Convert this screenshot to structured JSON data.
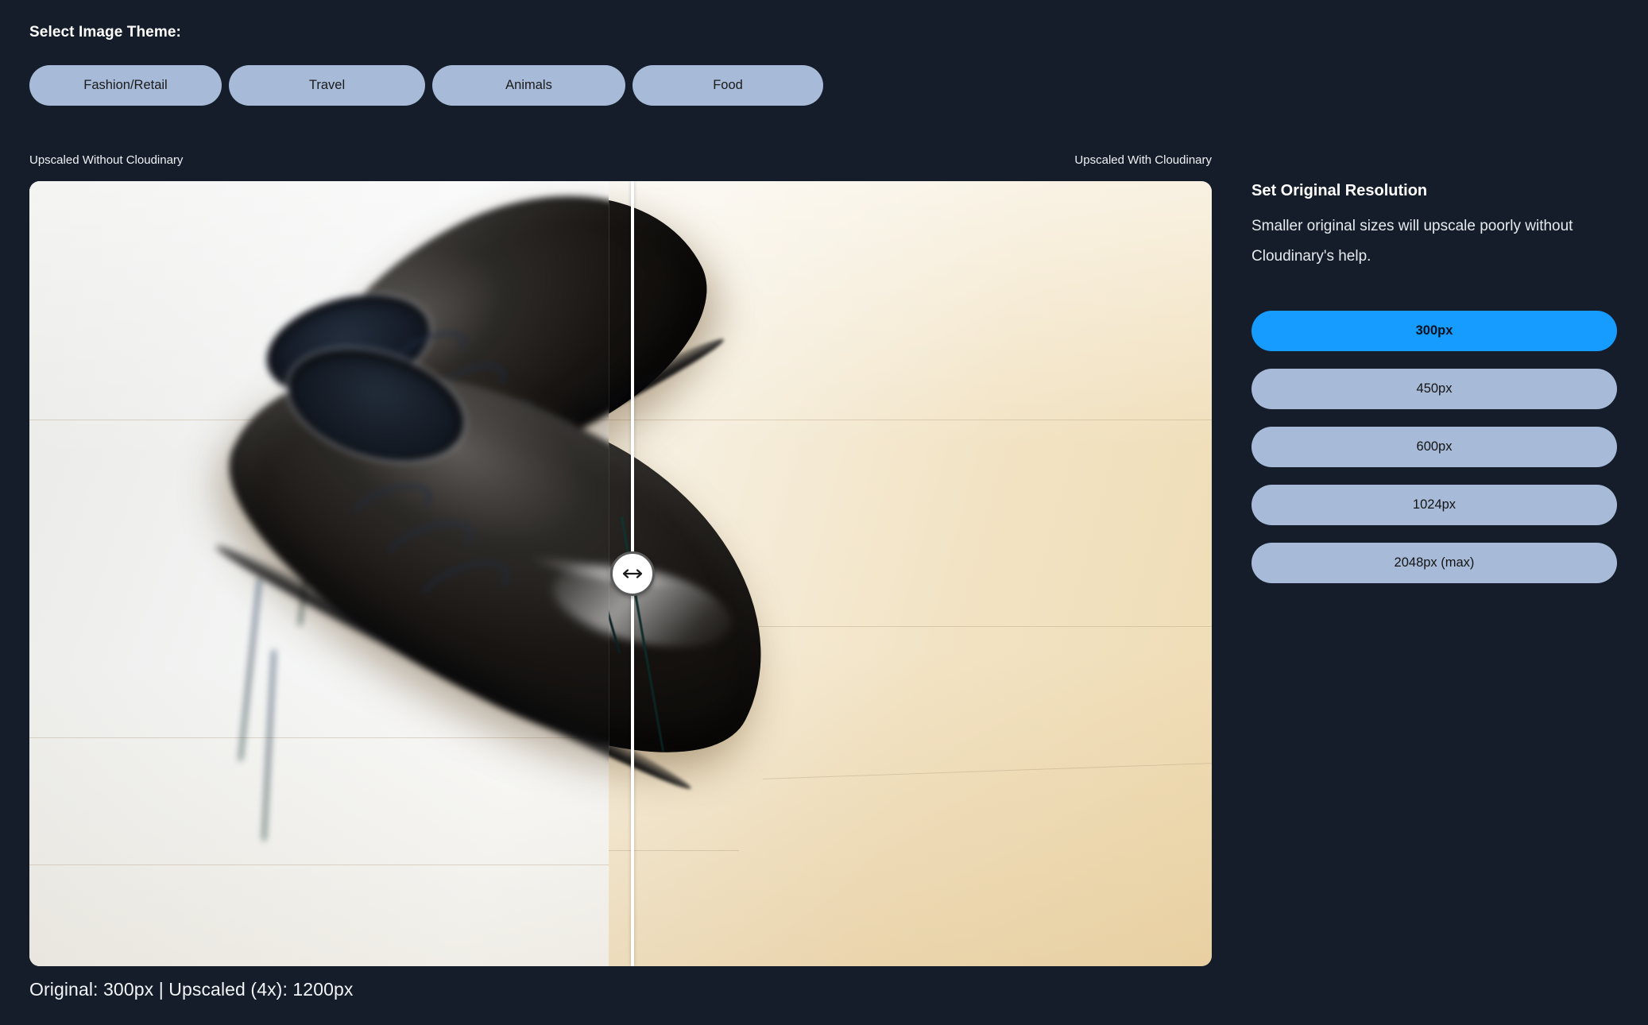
{
  "theme_selector": {
    "label": "Select Image Theme:",
    "options": [
      {
        "label": "Fashion/Retail",
        "selected": true
      },
      {
        "label": "Travel",
        "selected": false
      },
      {
        "label": "Animals",
        "selected": false
      },
      {
        "label": "Food",
        "selected": false
      }
    ]
  },
  "comparison": {
    "left_label": "Upscaled Without Cloudinary",
    "right_label": "Upscaled With Cloudinary",
    "handle_icon": "left-right-arrow-icon",
    "divider_position_percent": 51,
    "subject": "black leather dress shoes"
  },
  "footer": {
    "caption": "Original: 300px | Upscaled (4x): 1200px"
  },
  "side_panel": {
    "title": "Set Original Resolution",
    "description": "Smaller original sizes will upscale poorly without Cloudinary's help.",
    "resolutions": [
      {
        "label": "300px",
        "selected": true
      },
      {
        "label": "450px",
        "selected": false
      },
      {
        "label": "600px",
        "selected": false
      },
      {
        "label": "1024px",
        "selected": false
      },
      {
        "label": "2048px (max)",
        "selected": false
      }
    ]
  },
  "colors": {
    "background": "#141d29",
    "button": "#a7bbd8",
    "button_active": "#169bff",
    "text": "#ffffff",
    "divider": "#ffffff"
  }
}
